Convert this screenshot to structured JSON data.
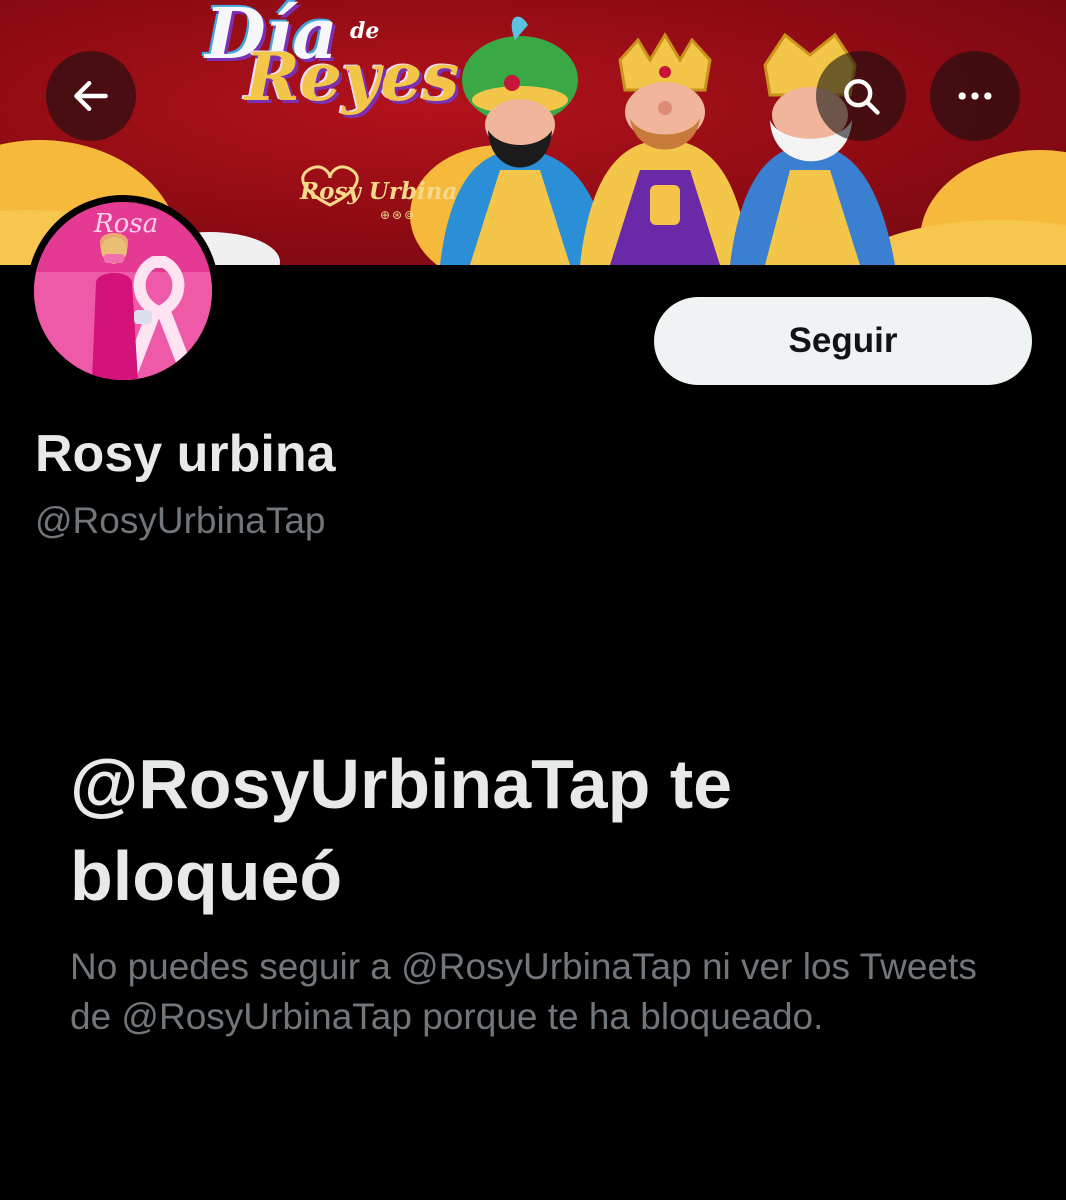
{
  "banner": {
    "title_line1": "Día",
    "title_de": "de",
    "title_line2": "Reyes",
    "brand": "Rosy Urbina",
    "brand_icons": "⊕⊛⊚"
  },
  "header": {
    "back_icon": "arrow-left-icon",
    "search_icon": "search-icon",
    "more_icon": "more-horizontal-icon"
  },
  "profile": {
    "display_name": "Rosy urbina",
    "handle": "@RosyUrbinaTap",
    "follow_label": "Seguir",
    "avatar_text": "Rosa"
  },
  "blocked": {
    "title": "@RosyUrbinaTap te bloqueó",
    "description": "No puedes seguir a @RosyUrbinaTap ni ver los Tweets de @RosyUrbinaTap porque te ha bloqueado."
  },
  "colors": {
    "background": "#000000",
    "primary_text": "#e7e9ea",
    "secondary_text": "#71767b",
    "follow_button_bg": "#eff3f4",
    "banner_red": "#8e0b13"
  }
}
